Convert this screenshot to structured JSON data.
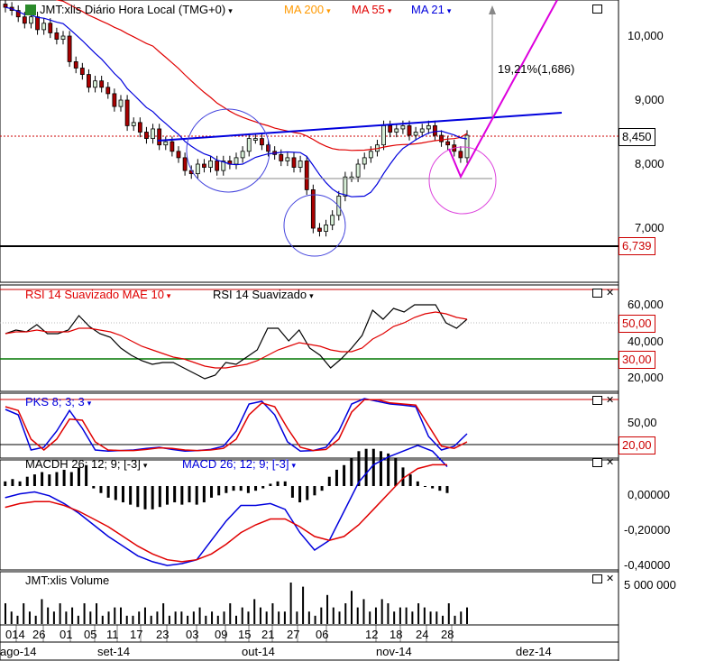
{
  "chart_data": [
    {
      "type": "candlestick",
      "title": "JMT:xlis Diário Hora Local (TMG+0)",
      "legend": [
        {
          "name": "MA 200",
          "color": "#ff9900"
        },
        {
          "name": "MA 55",
          "color": "#e00000"
        },
        {
          "name": "MA 21",
          "color": "#0000dd"
        }
      ],
      "y_ticks": [
        "10,000",
        "9,000",
        "8,000",
        "7,000"
      ],
      "ylim": [
        6.3,
        10.55
      ],
      "last_price": "8,450",
      "support_level": "6,739",
      "annotation": "19,21%(1,686)",
      "closes": [
        10.45,
        10.4,
        10.3,
        10.2,
        10.3,
        10.1,
        10.2,
        10.05,
        9.95,
        10.0,
        9.6,
        9.5,
        9.4,
        9.2,
        9.3,
        9.2,
        9.1,
        8.9,
        9.0,
        8.6,
        8.65,
        8.5,
        8.4,
        8.55,
        8.3,
        8.35,
        8.2,
        8.1,
        7.9,
        7.85,
        8.0,
        7.95,
        8.05,
        7.9,
        8.05,
        8.0,
        8.1,
        8.2,
        8.4,
        8.4,
        8.3,
        8.2,
        8.15,
        8.05,
        8.1,
        7.95,
        8.05,
        7.6,
        7.0,
        6.95,
        7.05,
        7.2,
        7.5,
        7.8,
        7.8,
        8.0,
        8.1,
        8.2,
        8.3,
        8.6,
        8.5,
        8.55,
        8.6,
        8.45,
        8.5,
        8.55,
        8.6,
        8.45,
        8.35,
        8.3,
        8.2,
        8.1,
        8.45
      ]
    },
    {
      "type": "line",
      "title": "RSI 14 Suavizado",
      "legend": [
        {
          "name": "RSI 14 Suavizado MAE 10",
          "color": "#e00000"
        },
        {
          "name": "RSI 14 Suavizado",
          "color": "#000000"
        }
      ],
      "y_ticks": [
        "60,000",
        "40,000",
        "20,000"
      ],
      "levels": [
        "50,00",
        "30,00"
      ],
      "series": [
        {
          "name": "RSI 14 Suavizado",
          "values": [
            44,
            46,
            45,
            49,
            44,
            44,
            46,
            54,
            48,
            44,
            42,
            36,
            32,
            29,
            27,
            28,
            28,
            25,
            22,
            19,
            21,
            28,
            27,
            31,
            35,
            47,
            47,
            40,
            46,
            36,
            32,
            25,
            30,
            36,
            43,
            57,
            52,
            58,
            56,
            60,
            60,
            60,
            50,
            47,
            52
          ]
        },
        {
          "name": "RSI 14 Suavizado MAE 10",
          "values": [
            44,
            45,
            45,
            46,
            45,
            45,
            45,
            47,
            47,
            46,
            45,
            43,
            40,
            37,
            35,
            33,
            31,
            30,
            28,
            26,
            25,
            25,
            26,
            27,
            29,
            32,
            35,
            37,
            39,
            38,
            37,
            35,
            34,
            34,
            36,
            41,
            44,
            48,
            50,
            53,
            55,
            56,
            55,
            53,
            52
          ]
        }
      ]
    },
    {
      "type": "line",
      "title": "PKS 8; 3; 3",
      "y_ticks": [
        "50,00"
      ],
      "levels": [
        "20,00"
      ],
      "series": [
        {
          "name": "PKS 8; 3; 3",
          "values": [
            80,
            70,
            5,
            10,
            40,
            78,
            45,
            5,
            3,
            4,
            5,
            8,
            10,
            6,
            3,
            4,
            6,
            12,
            40,
            90,
            95,
            70,
            20,
            3,
            4,
            10,
            40,
            90,
            100,
            95,
            90,
            88,
            85,
            30,
            5,
            12,
            35
          ]
        },
        {
          "name": "signal",
          "values": [
            85,
            78,
            25,
            5,
            25,
            62,
            60,
            20,
            5,
            4,
            4,
            6,
            9,
            8,
            5,
            4,
            5,
            8,
            25,
            70,
            92,
            85,
            45,
            10,
            4,
            6,
            25,
            75,
            98,
            98,
            92,
            90,
            88,
            50,
            12,
            8,
            20
          ]
        }
      ]
    },
    {
      "type": "bar",
      "title": "MACD 26; 12; 9; [-3]",
      "legend": [
        {
          "name": "MACDH 26; 12; 9; [-3]",
          "color": "#000000"
        },
        {
          "name": "MACD 26; 12; 9; [-3]",
          "color": "#0000dd"
        }
      ],
      "y_ticks": [
        "0,00000",
        "-0,20000",
        "-0,40000"
      ],
      "histogram": [
        0.02,
        0.03,
        0.02,
        0.04,
        0.05,
        0.06,
        0.05,
        0.06,
        0.07,
        0.06,
        0.08,
        0.09,
        -0.01,
        -0.03,
        -0.05,
        -0.06,
        -0.07,
        -0.08,
        -0.09,
        -0.1,
        -0.1,
        -0.09,
        -0.08,
        -0.07,
        -0.08,
        -0.07,
        -0.08,
        -0.07,
        -0.05,
        -0.04,
        -0.03,
        -0.02,
        -0.02,
        -0.03,
        -0.02,
        -0.01,
        0.01,
        0.02,
        0.02,
        -0.05,
        -0.07,
        -0.06,
        -0.04,
        -0.02,
        0.04,
        0.07,
        0.09,
        0.12,
        0.15,
        0.16,
        0.16,
        0.15,
        0.14,
        0.12,
        0.08,
        0.05,
        0.02,
        0.0,
        -0.01,
        -0.02,
        -0.03
      ],
      "series": [
        {
          "name": "MACD 26; 12; 9; [-3]",
          "values": [
            -0.06,
            -0.04,
            -0.03,
            -0.05,
            -0.09,
            -0.14,
            -0.2,
            -0.26,
            -0.31,
            -0.36,
            -0.39,
            -0.41,
            -0.4,
            -0.38,
            -0.28,
            -0.18,
            -0.1,
            -0.1,
            -0.09,
            -0.12,
            -0.24,
            -0.33,
            -0.28,
            -0.13,
            0.02,
            0.11,
            0.15,
            0.18,
            0.21,
            0.18,
            0.1
          ]
        },
        {
          "name": "signal",
          "values": [
            -0.11,
            -0.09,
            -0.08,
            -0.08,
            -0.1,
            -0.13,
            -0.17,
            -0.21,
            -0.26,
            -0.31,
            -0.35,
            -0.38,
            -0.39,
            -0.38,
            -0.35,
            -0.3,
            -0.24,
            -0.2,
            -0.17,
            -0.17,
            -0.21,
            -0.26,
            -0.28,
            -0.26,
            -0.2,
            -0.12,
            -0.04,
            0.04,
            0.09,
            0.11,
            0.11
          ]
        }
      ]
    },
    {
      "type": "bar",
      "title": "JMT:xlis Volume",
      "y_ticks": [
        "5 000 000"
      ],
      "values": [
        0.5,
        0.3,
        0.2,
        0.5,
        0.3,
        0.2,
        0.6,
        0.4,
        0.3,
        0.5,
        0.3,
        0.4,
        0.2,
        0.5,
        0.3,
        0.5,
        0.2,
        0.3,
        0.4,
        0.4,
        0.2,
        0.2,
        0.3,
        0.4,
        0.2,
        0.3,
        0.5,
        0.2,
        0.3,
        0.3,
        0.2,
        0.3,
        0.4,
        0.2,
        0.3,
        0.2,
        0.3,
        0.5,
        0.2,
        0.4,
        0.3,
        0.6,
        0.4,
        0.3,
        0.5,
        0.3,
        0.3,
        1.0,
        0.3,
        0.9,
        0.3,
        0.2,
        0.4,
        0.7,
        0.4,
        0.3,
        0.5,
        0.8,
        0.4,
        0.6,
        0.3,
        0.4,
        0.6,
        0.5,
        0.3,
        0.4,
        0.4,
        0.3,
        0.5,
        0.4,
        0.3,
        0.3,
        0.2,
        0.5,
        0.2,
        0.3,
        0.4
      ]
    }
  ],
  "x_ticks": [
    "014",
    "26",
    "01",
    "05",
    "11",
    "17",
    "23",
    "03",
    "09",
    "15",
    "21",
    "27",
    "06",
    "12",
    "18",
    "24",
    "28"
  ],
  "x_months": [
    "ago-14",
    "set-14",
    "out-14",
    "nov-14",
    "dez-14"
  ]
}
